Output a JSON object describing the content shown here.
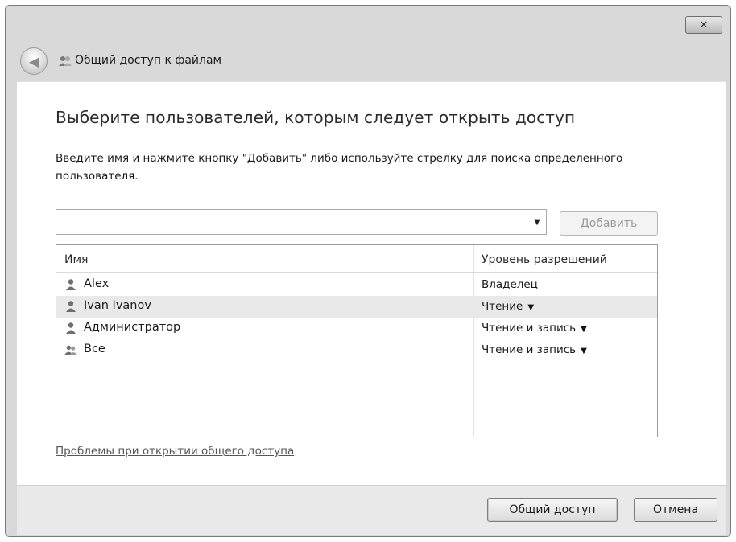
{
  "window": {
    "close_glyph": "✕",
    "back_glyph": "◀",
    "title": "Общий доступ к файлам",
    "title_icon": "users-icon"
  },
  "main": {
    "heading": "Выберите пользователей, которым следует открыть доступ",
    "instructions": "Введите имя и нажмите кнопку \"Добавить\" либо используйте стрелку для поиска определенного пользователя.",
    "combo": {
      "value": "",
      "arrow_glyph": "▼"
    },
    "add_button": "Добавить"
  },
  "list": {
    "columns": [
      "Имя",
      "Уровень разрешений"
    ],
    "rows": [
      {
        "name": "Alex",
        "permission": "Владелец",
        "dropdown": false,
        "icon": "user-icon",
        "selected": false
      },
      {
        "name": "Ivan Ivanov",
        "permission": "Чтение",
        "dropdown": true,
        "icon": "user-icon",
        "selected": true
      },
      {
        "name": "Администратор",
        "permission": "Чтение и запись",
        "dropdown": true,
        "icon": "user-icon",
        "selected": false
      },
      {
        "name": "Все",
        "permission": "Чтение и запись",
        "dropdown": true,
        "icon": "group-icon",
        "selected": false
      }
    ],
    "dropdown_glyph": "▼"
  },
  "help_link": "Проблемы при открытии общего доступа",
  "footer": {
    "share_button": "Общий доступ",
    "cancel_button": "Отмена"
  }
}
